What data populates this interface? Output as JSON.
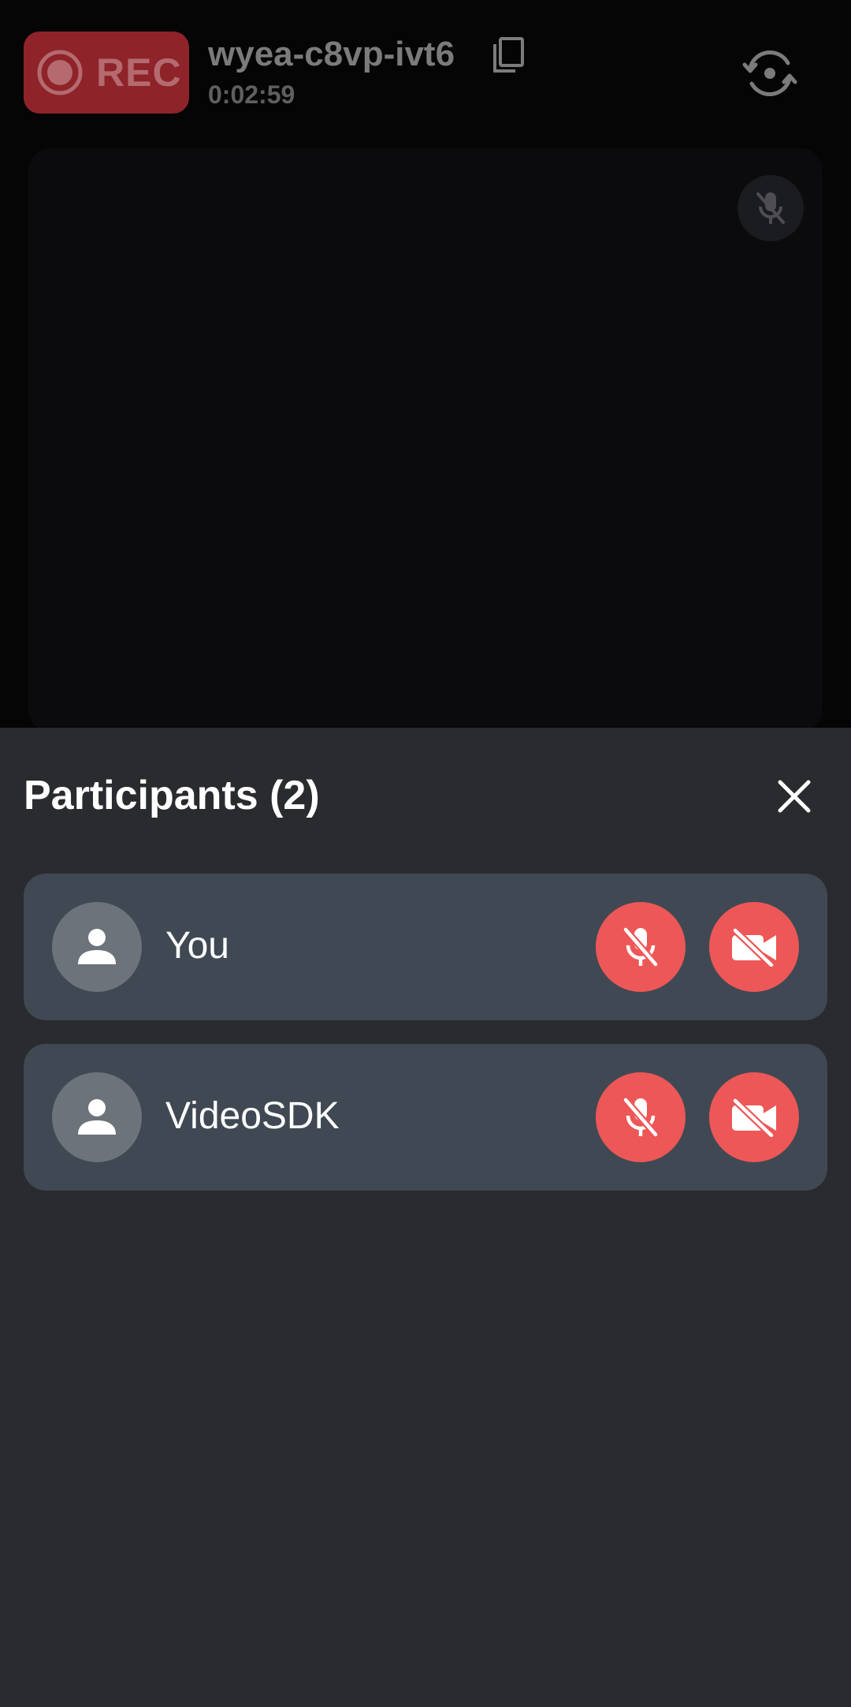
{
  "header": {
    "rec_label": "REC",
    "meeting_id": "wyea-c8vp-ivt6",
    "timer": "0:02:59"
  },
  "sheet": {
    "title": "Participants (2)"
  },
  "participants": [
    {
      "name": "You",
      "mic": "muted",
      "camera": "off"
    },
    {
      "name": "VideoSDK",
      "mic": "muted",
      "camera": "off"
    }
  ],
  "colors": {
    "rec_badge": "#8e232a",
    "sheet_bg": "#292b2f",
    "row_bg": "#404953",
    "control_red": "#ee5757",
    "avatar_bg": "#6d737b"
  },
  "icons": {
    "rec": "record-icon",
    "copy": "copy-icon",
    "switch_camera": "switch-camera-icon",
    "tile_mic_off": "mic-off-icon",
    "close": "close-icon",
    "avatar": "person-icon",
    "mic_off": "mic-off-icon",
    "camera_off": "camera-off-icon"
  }
}
